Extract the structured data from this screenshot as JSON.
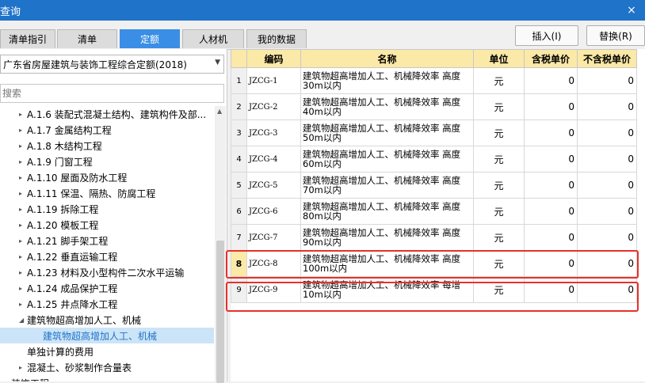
{
  "window": {
    "title": "查询",
    "close_label": "×"
  },
  "tabs": [
    {
      "label": "清单指引",
      "active": false
    },
    {
      "label": "清单",
      "active": false
    },
    {
      "label": "定额",
      "active": true
    },
    {
      "label": "人材机",
      "active": false
    },
    {
      "label": "我的数据",
      "active": false
    }
  ],
  "toolbar": {
    "insert_label": "插入(I)",
    "replace_label": "替换(R)"
  },
  "left": {
    "quota_library": "广东省房屋建筑与装饰工程综合定额(2018)",
    "search_placeholder": "搜索",
    "tree": [
      {
        "label": "A.1.6 装配式混凝土结构、建筑构件及部...",
        "exp": "▸",
        "level": 3,
        "selected": false
      },
      {
        "label": "A.1.7 金属结构工程",
        "exp": "▸",
        "level": 3,
        "selected": false
      },
      {
        "label": "A.1.8 木结构工程",
        "exp": "▸",
        "level": 3,
        "selected": false
      },
      {
        "label": "A.1.9 门窗工程",
        "exp": "▸",
        "level": 3,
        "selected": false
      },
      {
        "label": "A.1.10 屋面及防水工程",
        "exp": "▸",
        "level": 3,
        "selected": false
      },
      {
        "label": "A.1.11 保温、隔热、防腐工程",
        "exp": "▸",
        "level": 3,
        "selected": false
      },
      {
        "label": "A.1.19 拆除工程",
        "exp": "▸",
        "level": 3,
        "selected": false
      },
      {
        "label": "A.1.20 模板工程",
        "exp": "▸",
        "level": 3,
        "selected": false
      },
      {
        "label": "A.1.21 脚手架工程",
        "exp": "▸",
        "level": 3,
        "selected": false
      },
      {
        "label": "A.1.22 垂直运输工程",
        "exp": "▸",
        "level": 3,
        "selected": false
      },
      {
        "label": "A.1.23 材料及小型构件二次水平运输",
        "exp": "▸",
        "level": 3,
        "selected": false
      },
      {
        "label": "A.1.24 成品保护工程",
        "exp": "▸",
        "level": 3,
        "selected": false
      },
      {
        "label": "A.1.25 井点降水工程",
        "exp": "▸",
        "level": 3,
        "selected": false
      },
      {
        "label": "建筑物超高增加人工、机械",
        "exp": "◢",
        "level": 3,
        "selected": false
      },
      {
        "label": "建筑物超高增加人工、机械",
        "exp": "",
        "level": 4,
        "selected": true
      },
      {
        "label": "单独计算的费用",
        "exp": "",
        "level": 3,
        "selected": false
      },
      {
        "label": "混凝土、砂浆制作合量表",
        "exp": "▸",
        "level": 3,
        "selected": false
      },
      {
        "label": "装饰工程",
        "exp": "▸",
        "level": 1,
        "selected": false
      }
    ]
  },
  "grid": {
    "columns": [
      "",
      "编码",
      "名称",
      "单位",
      "含税单价",
      "不含税单价"
    ],
    "rows": [
      {
        "num": "1",
        "code": "JZCG-1",
        "name": "建筑物超高增加人工、机械降效率 高度30m以内",
        "unit": "元",
        "price_tax": "0",
        "price_notax": "0"
      },
      {
        "num": "2",
        "code": "JZCG-2",
        "name": "建筑物超高增加人工、机械降效率 高度40m以内",
        "unit": "元",
        "price_tax": "0",
        "price_notax": "0"
      },
      {
        "num": "3",
        "code": "JZCG-3",
        "name": "建筑物超高增加人工、机械降效率 高度50m以内",
        "unit": "元",
        "price_tax": "0",
        "price_notax": "0"
      },
      {
        "num": "4",
        "code": "JZCG-4",
        "name": "建筑物超高增加人工、机械降效率 高度60m以内",
        "unit": "元",
        "price_tax": "0",
        "price_notax": "0"
      },
      {
        "num": "5",
        "code": "JZCG-5",
        "name": "建筑物超高增加人工、机械降效率 高度70m以内",
        "unit": "元",
        "price_tax": "0",
        "price_notax": "0"
      },
      {
        "num": "6",
        "code": "JZCG-6",
        "name": "建筑物超高增加人工、机械降效率 高度80m以内",
        "unit": "元",
        "price_tax": "0",
        "price_notax": "0"
      },
      {
        "num": "7",
        "code": "JZCG-7",
        "name": "建筑物超高增加人工、机械降效率 高度90m以内",
        "unit": "元",
        "price_tax": "0",
        "price_notax": "0"
      },
      {
        "num": "8",
        "code": "JZCG-8",
        "name": "建筑物超高增加人工、机械降效率 高度100m以内",
        "unit": "元",
        "price_tax": "0",
        "price_notax": "0"
      },
      {
        "num": "9",
        "code": "JZCG-9",
        "name": "建筑物超高增加人工、机械降效率 每增10m以内",
        "unit": "元",
        "price_tax": "0",
        "price_notax": "0"
      }
    ],
    "current_row": 7
  },
  "colors": {
    "accent": "#3a8ee6",
    "titlebar": "#1f73c9",
    "header": "#fbe9a7",
    "highlight": "#e8302a"
  }
}
